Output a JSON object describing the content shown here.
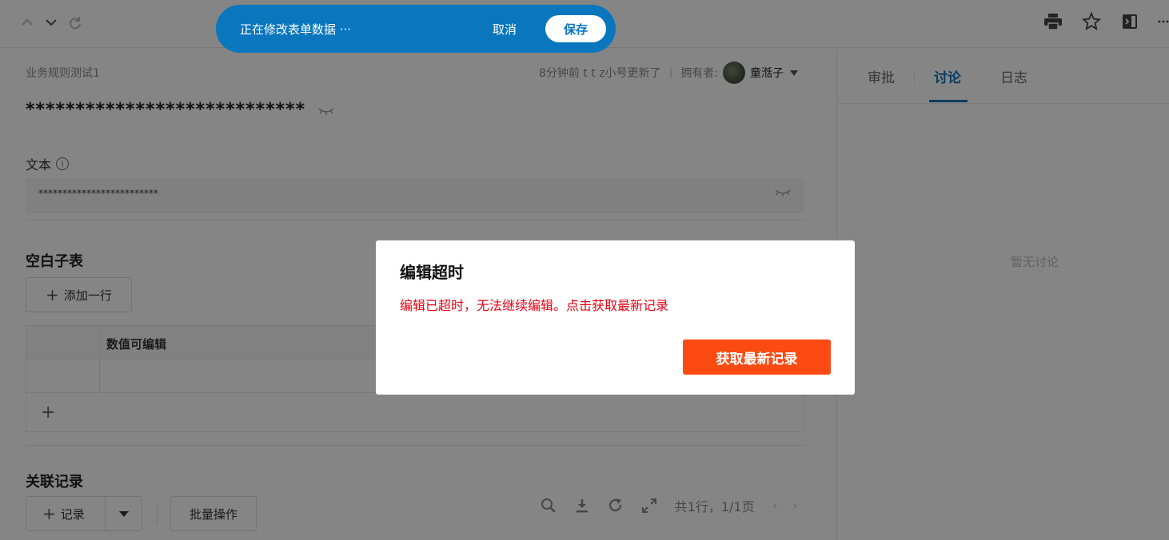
{
  "edit_bar": {
    "message": "正在修改表单数据 ···",
    "cancel": "取消",
    "save": "保存"
  },
  "record": {
    "breadcrumb": "业务规则测试1",
    "updated": "8分钟前 t t z小号更新了",
    "separator": "|",
    "owner_label": "拥有者:",
    "owner_name": "童湉子",
    "masked_title": "****************************"
  },
  "text_field": {
    "label": "文本",
    "value": "*************************"
  },
  "subtable": {
    "title": "空白子表",
    "add_row": "添加一行",
    "column": "数值可编辑",
    "add_symbol": "+"
  },
  "related": {
    "title": "关联记录",
    "add_record": "记录",
    "batch": "批量操作",
    "pager": "共1行，1/1页",
    "prev": "‹",
    "next": "›"
  },
  "side": {
    "tabs": [
      "审批",
      "讨论",
      "日志"
    ],
    "active_tab": "讨论",
    "empty": "暂无讨论"
  },
  "dialog": {
    "title": "编辑超时",
    "message": "编辑已超时，无法继续编辑。点击获取最新记录",
    "button": "获取最新记录"
  },
  "colors": {
    "primary": "#0a76bd",
    "danger_text": "#e60012",
    "action": "#fc4a13"
  },
  "icons": [
    "chevron-up-icon",
    "chevron-down-icon",
    "refresh-icon",
    "print-icon",
    "star-icon",
    "side-panel-icon",
    "more-icon",
    "eye-closed-icon",
    "info-icon",
    "plus-icon",
    "search-icon",
    "download-icon",
    "reload-icon",
    "expand-icon"
  ]
}
